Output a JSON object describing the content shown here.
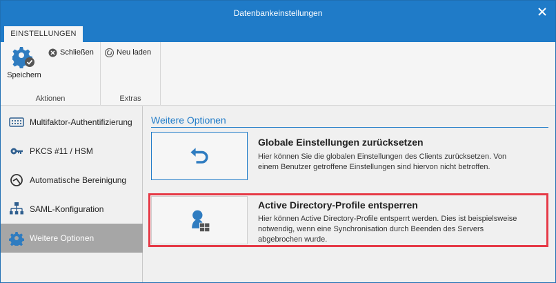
{
  "window": {
    "title": "Datenbankeinstellungen"
  },
  "ribbon": {
    "tab_label": "EINSTELLUNGEN",
    "groups": {
      "actions": {
        "label": "Aktionen",
        "save_label": "Speichern",
        "close_label": "Schließen"
      },
      "extras": {
        "label": "Extras",
        "reload_label": "Neu laden"
      }
    }
  },
  "sidebar": {
    "items": [
      {
        "label": "Multifaktor-Authentifizierung",
        "icon": "keypad-icon"
      },
      {
        "label": "PKCS #11 / HSM",
        "icon": "key-icon"
      },
      {
        "label": "Automatische Bereinigung",
        "icon": "cleanup-icon"
      },
      {
        "label": "SAML-Konfiguration",
        "icon": "network-icon"
      },
      {
        "label": "Weitere Optionen",
        "icon": "gear-icon",
        "active": true
      }
    ]
  },
  "main": {
    "section_title": "Weitere Optionen",
    "options": [
      {
        "title": "Globale Einstellungen zurücksetzen",
        "description_line1": "Hier können Sie die globalen Einstellungen des Clients zurücksetzen. Von",
        "description_line2": "einem Benutzer getroffene Einstellungen sind hiervon nicht betroffen.",
        "icon": "undo-icon"
      },
      {
        "title": "Active Directory-Profile entsperren",
        "description_line1": "Hier können Active Directory-Profile entsperrt werden. Dies ist beispielsweise",
        "description_line2": "notwendig, wenn eine Synchronisation durch Beenden des Servers",
        "description_line3": "abgebrochen wurde.",
        "icon": "ad-profile-icon"
      }
    ]
  },
  "colors": {
    "accent": "#1f7bc8",
    "highlight": "#e63946",
    "active_item": "#a6a6a6"
  }
}
